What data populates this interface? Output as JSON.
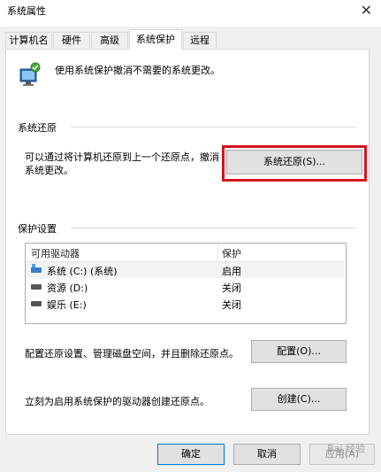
{
  "window": {
    "title": "系统属性"
  },
  "tabs": [
    {
      "label": "计算机名"
    },
    {
      "label": "硬件"
    },
    {
      "label": "高级"
    },
    {
      "label": "系统保护"
    },
    {
      "label": "远程"
    }
  ],
  "intro": {
    "text": "使用系统保护撤消不需要的系统更改。"
  },
  "restore": {
    "section_title": "系统还原",
    "description_line1": "可以通过将计算机还原到上一个还原点，撤消",
    "description_line2": "系统更改。",
    "button_label": "系统还原(S)..."
  },
  "protection": {
    "section_title": "保护设置",
    "columns": {
      "drive": "可用驱动器",
      "protection": "保护"
    },
    "drives": [
      {
        "name": "系统 (C:) (系统)",
        "status": "启用"
      },
      {
        "name": "资源 (D:)",
        "status": "关闭"
      },
      {
        "name": "娱乐 (E:)",
        "status": "关闭"
      }
    ],
    "configure_text": "配置还原设置、管理磁盘空间，并且删除还原点。",
    "configure_button": "配置(O)...",
    "create_text": "立刻为启用系统保护的驱动器创建还原点。",
    "create_button": "创建(C)..."
  },
  "footer": {
    "ok": "确定",
    "cancel": "取消",
    "apply": "应用(A)"
  },
  "watermark": "Bai 经验"
}
